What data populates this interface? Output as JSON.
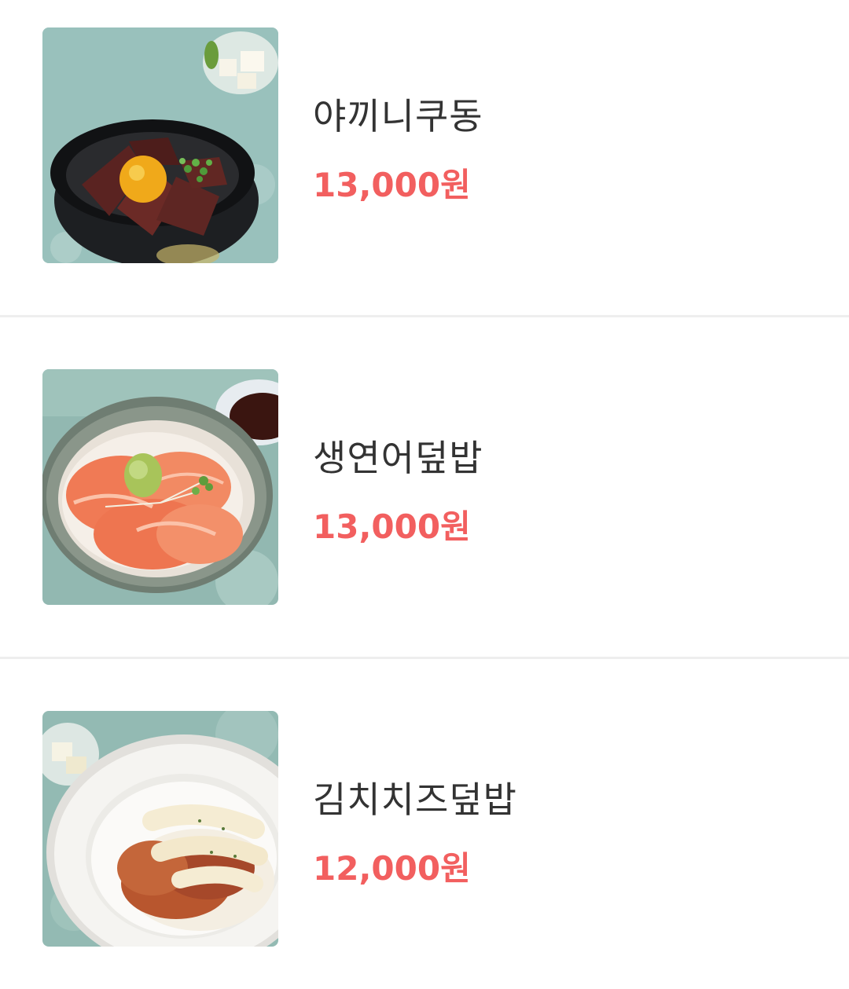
{
  "menu": {
    "items": [
      {
        "name": "야끼니쿠동",
        "price": "13,000원",
        "image_icon": "yakiniku-don-photo"
      },
      {
        "name": "생연어덮밥",
        "price": "13,000원",
        "image_icon": "salmon-don-photo"
      },
      {
        "name": "김치치즈덮밥",
        "price": "12,000원",
        "image_icon": "kimchi-cheese-don-photo"
      }
    ]
  },
  "colors": {
    "name_text": "#333333",
    "price_text": "#f25f5f",
    "divider": "#eeeeee",
    "background": "#ffffff"
  }
}
